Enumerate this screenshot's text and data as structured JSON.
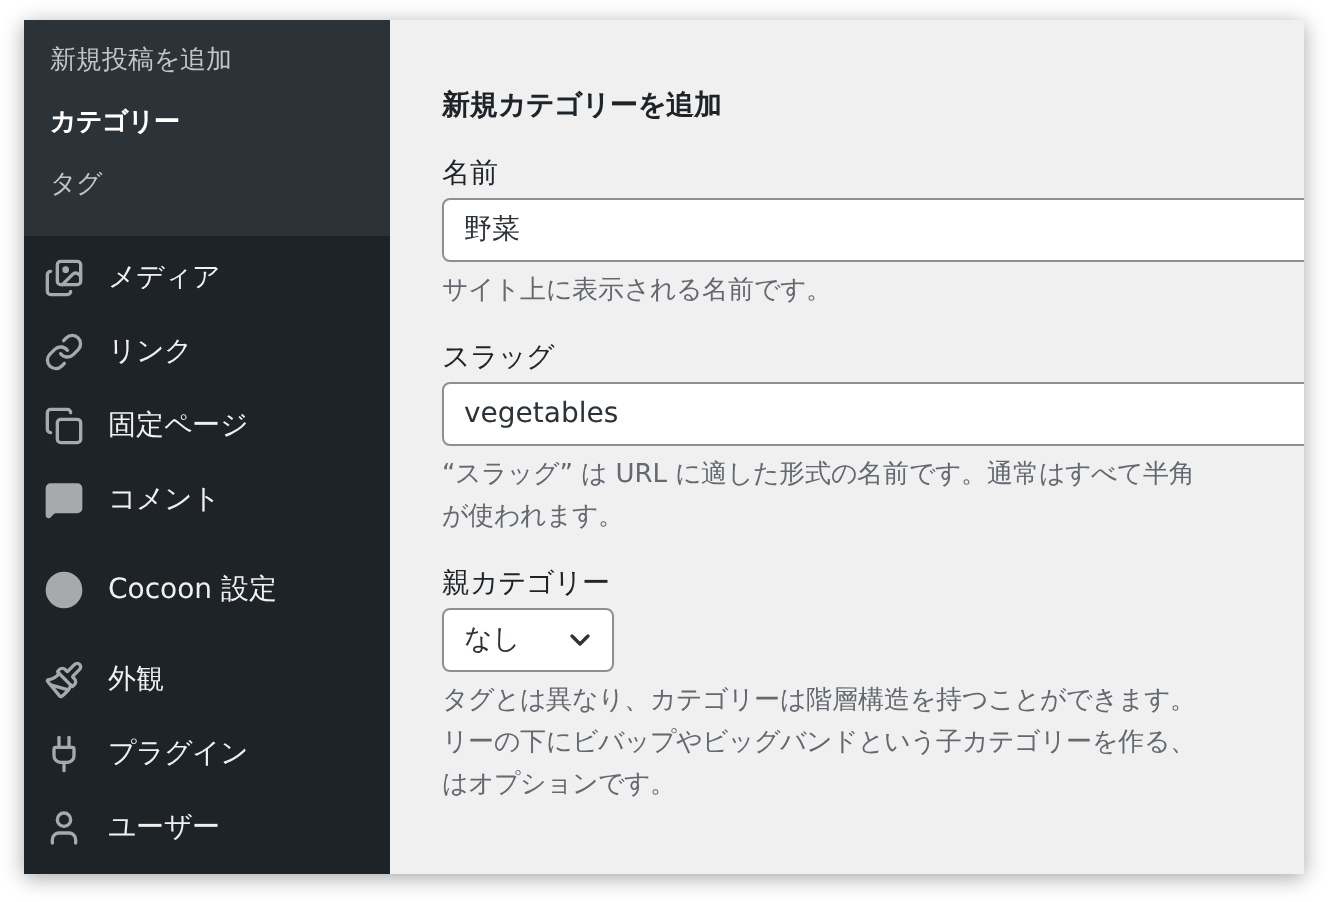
{
  "submenu": [
    {
      "label": "新規投稿を追加",
      "selected": false
    },
    {
      "label": "カテゴリー",
      "selected": true
    },
    {
      "label": "タグ",
      "selected": false
    }
  ],
  "menu": [
    {
      "label": "メディア",
      "kind": "media"
    },
    {
      "label": "リンク",
      "kind": "link"
    },
    {
      "label": "固定ページ",
      "kind": "pages"
    },
    {
      "label": "コメント",
      "kind": "comments"
    },
    {
      "label": "Cocoon 設定",
      "kind": "cocoon"
    },
    {
      "label": "外観",
      "kind": "appearance"
    },
    {
      "label": "プラグイン",
      "kind": "plugins"
    },
    {
      "label": "ユーザー",
      "kind": "users"
    }
  ],
  "form": {
    "title": "新規カテゴリーを追加",
    "name": {
      "label": "名前",
      "value": "野菜",
      "hint": [
        "サイト上に表示される名前です。"
      ]
    },
    "slug": {
      "label": "スラッグ",
      "value": "vegetables",
      "hint": [
        "“スラッグ” は URL に適した形式の名前です。通常はすべて半角",
        "が使われます。"
      ]
    },
    "parent": {
      "label": "親カテゴリー",
      "value": "なし",
      "hint": [
        "タグとは異なり、カテゴリーは階層構造を持つことができます。",
        "リーの下にビバップやビッグバンドという子カテゴリーを作る、",
        "はオプションです。"
      ]
    }
  }
}
